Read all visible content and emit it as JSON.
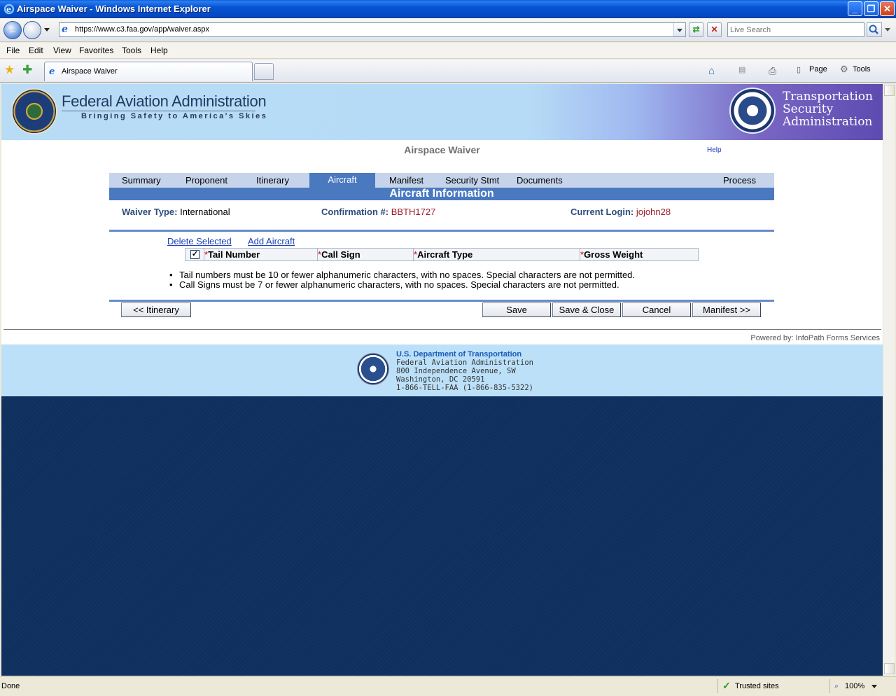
{
  "window": {
    "title": "Airspace Waiver - Windows Internet Explorer"
  },
  "address": {
    "url": "https://www.c3.faa.gov/app/waiver.aspx",
    "search_placeholder": "Live Search"
  },
  "menu": [
    "File",
    "Edit",
    "View",
    "Favorites",
    "Tools",
    "Help"
  ],
  "tab": {
    "title": "Airspace Waiver"
  },
  "commands": {
    "page": "Page",
    "tools": "Tools"
  },
  "banner": {
    "faa_name": "Federal Aviation Administration",
    "faa_tagline": "Bringing Safety to America's Skies",
    "tsa_line1": "Transportation",
    "tsa_line2": "Security",
    "tsa_line3": "Administration"
  },
  "form": {
    "title": "Airspace Waiver",
    "help": "Help",
    "tabs": [
      "Summary",
      "Proponent",
      "Itinerary",
      "Aircraft",
      "Manifest",
      "Security Stmt",
      "Documents",
      "Process"
    ],
    "active_tab": "Aircraft",
    "section_title": "Aircraft Information",
    "waiver_type_label": "Waiver Type:",
    "waiver_type_value": "International",
    "confirmation_label": "Confirmation #:",
    "confirmation_value": "BBTH1727",
    "login_label": "Current Login:",
    "login_value": "jojohn28",
    "delete_selected": "Delete Selected",
    "add_aircraft": "Add Aircraft",
    "columns": [
      "Tail Number",
      "Call Sign",
      "Aircraft Type",
      "Gross Weight"
    ],
    "notes": [
      "Tail numbers must be 10 or fewer alphanumeric characters, with no spaces.  Special characters are not permitted.",
      "Call Signs must be 7 or fewer alphanumeric characters, with no spaces.  Special characters are not permitted."
    ],
    "buttons": {
      "prev": "<< Itinerary",
      "save": "Save",
      "save_close": "Save & Close",
      "cancel": "Cancel",
      "next": "Manifest >>"
    }
  },
  "footer": {
    "powered_by": "Powered by: InfoPath Forms Services",
    "dot_org": "U.S. Department of Transportation",
    "dot_line1": "Federal Aviation Administration",
    "dot_line2": "800 Independence Avenue, SW",
    "dot_line3": "Washington, DC 20591",
    "dot_line4": "1-866-TELL-FAA (1-866-835-5322)"
  },
  "status": {
    "left": "Done",
    "zone": "Trusted sites",
    "zoom": "100%"
  }
}
